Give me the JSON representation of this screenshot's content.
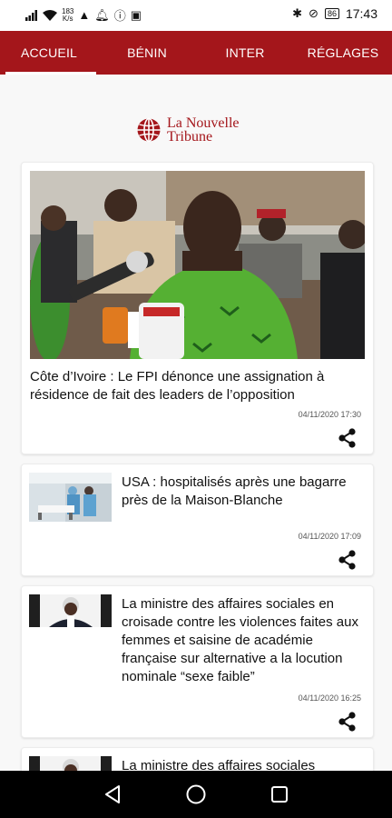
{
  "status_bar": {
    "speed_value": "183",
    "speed_unit": "K/s",
    "battery": "86",
    "time": "17:43"
  },
  "tabs": [
    {
      "label": "ACCUEIL",
      "active": true
    },
    {
      "label": "BÉNIN",
      "active": false
    },
    {
      "label": "INTER",
      "active": false
    },
    {
      "label": "RÉGLAGES",
      "active": false
    }
  ],
  "brand": {
    "name_line1": "La Nouvelle",
    "name_line2": "Tribune",
    "color": "#a4161b"
  },
  "articles": [
    {
      "title": "Côte d’Ivoire : Le FPI dénonce une assignation à résidence de fait des leaders de l’opposition",
      "date": "04/11/2020 17:30"
    },
    {
      "title": "USA : hospitalisés après une bagarre près de la Maison-Blanche",
      "date": "04/11/2020 17:09"
    },
    {
      "title": "La ministre des affaires sociales en croisade contre les violences faites aux femmes et saisine de académie française sur alternative a la locution nominale “sexe faible”",
      "date": "04/11/2020 16:25"
    },
    {
      "title": "La ministre des affaires sociales",
      "date": ""
    }
  ],
  "icons": {
    "share": "share-icon",
    "back": "back-triangle-icon",
    "home": "home-circle-icon",
    "recents": "recents-square-icon"
  }
}
